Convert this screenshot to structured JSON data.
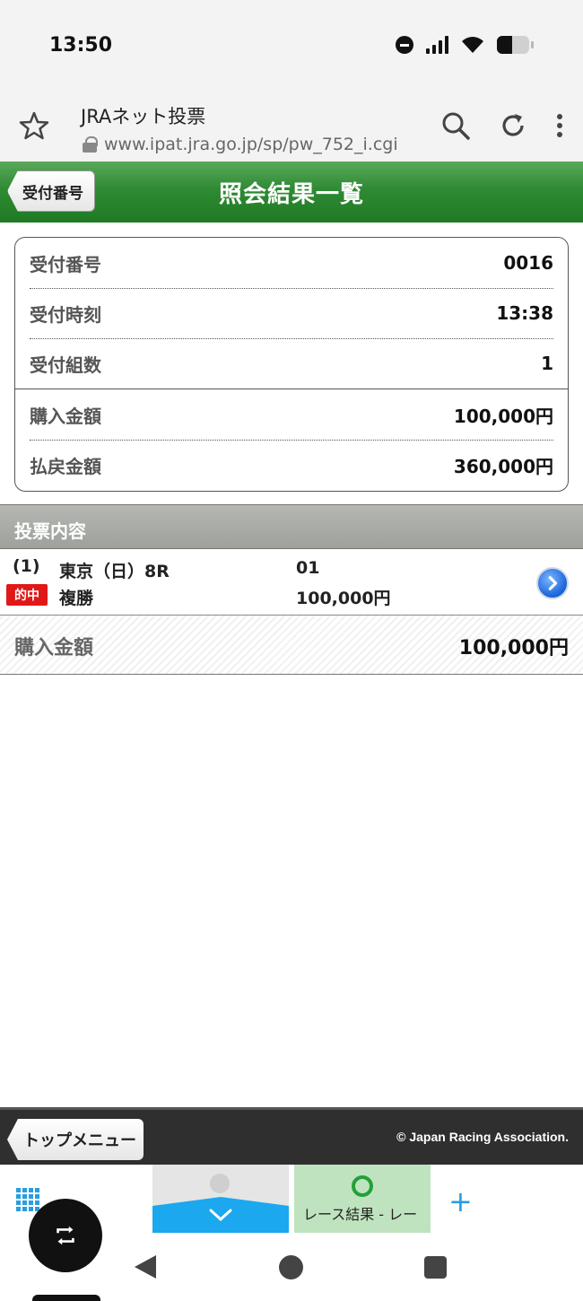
{
  "status_bar": {
    "time": "13:50"
  },
  "browser": {
    "title": "JRAネット投票",
    "url": "www.ipat.jra.go.jp/sp/pw_752_i.cgi"
  },
  "header": {
    "title": "照会結果一覧",
    "back_label": "受付番号",
    "accent_color": "#2f8a34"
  },
  "summary": {
    "rows": [
      {
        "label": "受付番号",
        "value": "0016"
      },
      {
        "label": "受付時刻",
        "value": "13:38"
      },
      {
        "label": "受付組数",
        "value": "1"
      },
      {
        "label": "購入金額",
        "value": "100,000円"
      },
      {
        "label": "払戻金額",
        "value": "360,000円"
      }
    ]
  },
  "section": {
    "title": "投票内容"
  },
  "bets": [
    {
      "number": "(1)",
      "race": "東京（日）8R",
      "badge": "的中",
      "bet_type": "複勝",
      "horse": "01",
      "amount": "100,000円"
    }
  ],
  "total": {
    "label": "購入金額",
    "value": "100,000円"
  },
  "footer": {
    "top_menu_label": "トップメニュー",
    "copyright": "© Japan Racing Association."
  },
  "tabs": {
    "second_tab_label": "レース結果 - レー"
  }
}
